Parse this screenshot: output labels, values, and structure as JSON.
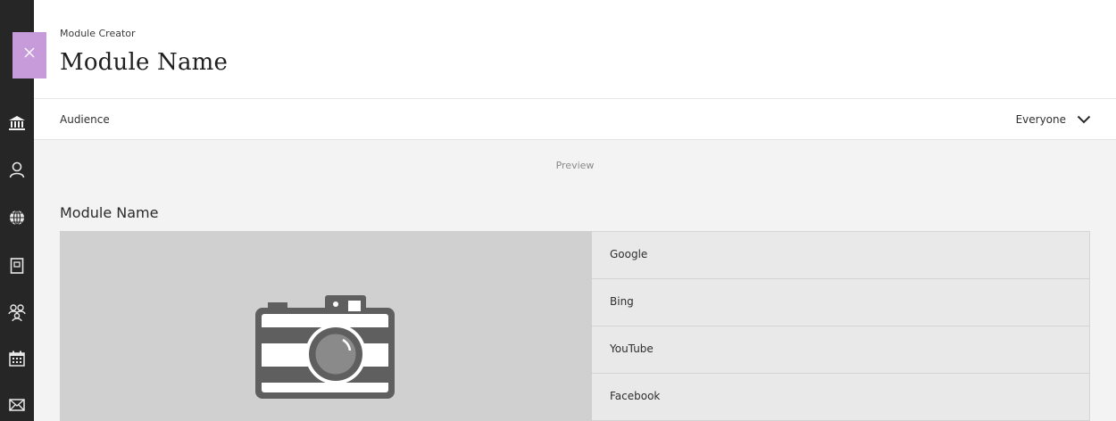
{
  "header": {
    "eyebrow": "Module Creator",
    "title": "Module Name"
  },
  "audience": {
    "label": "Audience",
    "value": "Everyone"
  },
  "preview": {
    "label": "Preview",
    "module_heading": "Module Name",
    "links": [
      "Google",
      "Bing",
      "YouTube",
      "Facebook"
    ]
  },
  "rail": {
    "icons": [
      "institution-icon",
      "user-icon",
      "globe-icon",
      "course-book-icon",
      "people-group-icon",
      "calendar-icon",
      "messages-icon"
    ]
  },
  "colors": {
    "rail": "#262626",
    "close_tab": "#c79ad9",
    "image_placeholder": "#d0d0d0",
    "link_panel": "#e9e9e9",
    "preview_bg": "#f3f3f3"
  }
}
